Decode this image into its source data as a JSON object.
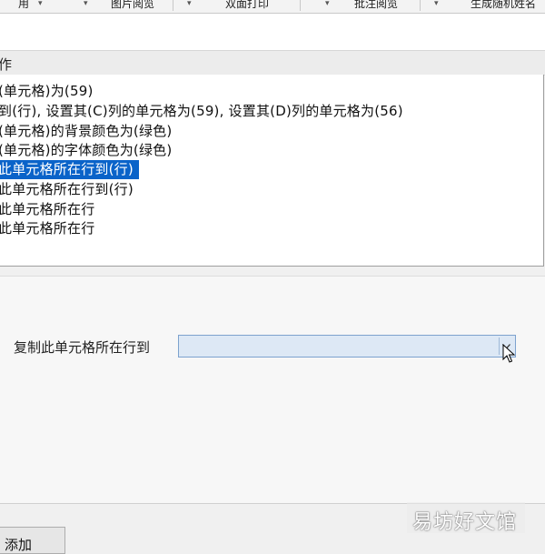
{
  "toolbar": {
    "items": [
      "用",
      "图片阅览",
      "双面打印",
      "批注阅览",
      "生成随机姓名"
    ]
  },
  "section": {
    "title": "作"
  },
  "list": {
    "items": [
      "(单元格)为(59)",
      "到(行), 设置其(C)列的单元格为(59), 设置其(D)列的单元格为(56)",
      "(单元格)的背景颜色为(绿色)",
      "(单元格)的字体颜色为(绿色)",
      "此单元格所在行到(行)",
      "此单元格所在行到(行)",
      "此单元格所在行",
      "此单元格所在行"
    ],
    "selected_index": 4
  },
  "form": {
    "label": "复制此单元格所在行到",
    "value": ""
  },
  "buttons": {
    "add": "添加"
  },
  "watermark": {
    "text": "易坊好文馆"
  },
  "colors": {
    "selection": "#0a63c9",
    "combo_bg": "#dde8f5",
    "combo_border": "#7da2ce"
  }
}
